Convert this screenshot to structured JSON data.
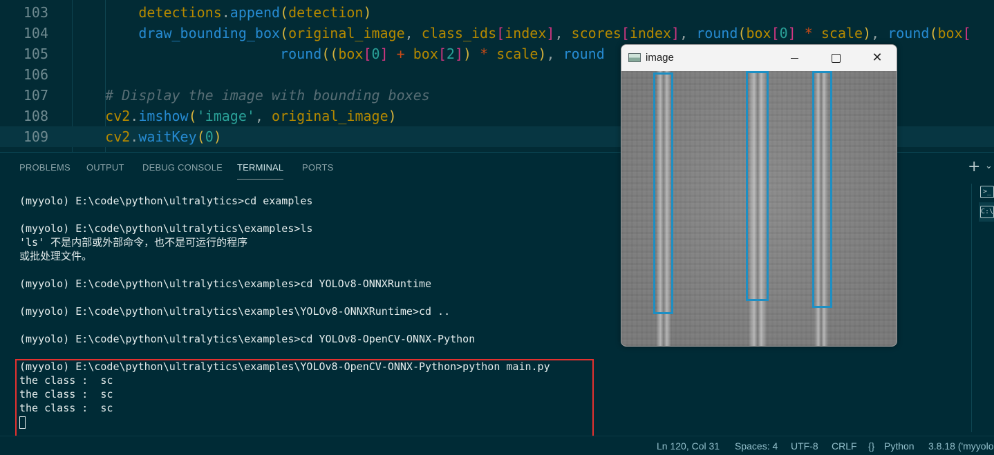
{
  "editor": {
    "lines": [
      {
        "num": "103",
        "html": "        <span class='kw-var'>detections</span>.<span class='fn'>append</span><span class='paren'>(</span><span class='kw-var'>detection</span><span class='paren'>)</span>"
      },
      {
        "num": "104",
        "html": "        <span class='fn'>draw_bounding_box</span><span class='paren'>(</span><span class='kw-var'>original_image</span>, <span class='kw-var'>class_ids</span><span class='brk'>[</span><span class='kw-var'>index</span><span class='brk'>]</span>, <span class='kw-var'>scores</span><span class='brk'>[</span><span class='kw-var'>index</span><span class='brk'>]</span>, <span class='fn'>round</span><span class='paren'>(</span><span class='kw-var'>box</span><span class='brk'>[</span><span class='num'>0</span><span class='brk'>]</span> <span class='op'>*</span> <span class='kw-var'>scale</span><span class='paren'>)</span>, <span class='fn'>round</span><span class='paren'>(</span><span class='kw-var'>box</span><span class='brk'>[</span>"
      },
      {
        "num": "105",
        "html": "                         <span class='fn'>round</span><span class='paren'>((</span><span class='kw-var'>box</span><span class='brk'>[</span><span class='num'>0</span><span class='brk'>]</span> <span class='op'>+</span> <span class='kw-var'>box</span><span class='brk'>[</span><span class='num'>2</span><span class='brk'>]</span><span class='paren'>)</span> <span class='op'>*</span> <span class='kw-var'>scale</span><span class='paren'>)</span>, <span class='fn'>round</span>"
      },
      {
        "num": "106",
        "html": ""
      },
      {
        "num": "107",
        "html": "    <span class='cmt'># Display the image with bounding boxes</span>"
      },
      {
        "num": "108",
        "html": "    <span class='kw-var'>cv2</span>.<span class='fn'>imshow</span><span class='paren'>(</span><span class='str'>'image'</span>, <span class='kw-var'>original_image</span><span class='paren'>)</span>"
      },
      {
        "num": "109",
        "html": "    <span class='kw-var'>cv2</span>.<span class='fn'>waitKey</span><span class='paren'>(</span><span class='num'>0</span><span class='paren'>)</span>"
      }
    ]
  },
  "panel": {
    "tabs": [
      "PROBLEMS",
      "OUTPUT",
      "DEBUG CONSOLE",
      "TERMINAL",
      "PORTS"
    ],
    "active_tab": "TERMINAL",
    "add_label": "+",
    "dropdown_label": "⌄"
  },
  "terminal": {
    "lines": [
      "(myyolo) E:\\code\\python\\ultralytics>cd examples",
      "",
      "(myyolo) E:\\code\\python\\ultralytics\\examples>ls",
      "'ls' 不是内部或外部命令，也不是可运行的程序",
      "或批处理文件。",
      "",
      "(myyolo) E:\\code\\python\\ultralytics\\examples>cd YOLOv8-ONNXRuntime",
      "",
      "(myyolo) E:\\code\\python\\ultralytics\\examples\\YOLOv8-ONNXRuntime>cd ..",
      "",
      "(myyolo) E:\\code\\python\\ultralytics\\examples>cd YOLOv8-OpenCV-ONNX-Python",
      "",
      "(myyolo) E:\\code\\python\\ultralytics\\examples\\YOLOv8-OpenCV-ONNX-Python>python main.py",
      "the class :  sc",
      "the class :  sc",
      "the class :  sc"
    ]
  },
  "statusbar": {
    "position": "Ln 120, Col 31",
    "spaces": "Spaces: 4",
    "encoding": "UTF-8",
    "eol": "CRLF",
    "language": "Python",
    "interpreter": "3.8.18 ('myyolo"
  },
  "image_window": {
    "title": "image",
    "minimize": "",
    "maximize": "",
    "close": "✕",
    "detections_count": 3,
    "bbox_color": "#1d8fc4"
  },
  "colors": {
    "editor_bg": "#022b35",
    "panel_bg": "#002b36",
    "highlight_border": "#e5312f"
  }
}
